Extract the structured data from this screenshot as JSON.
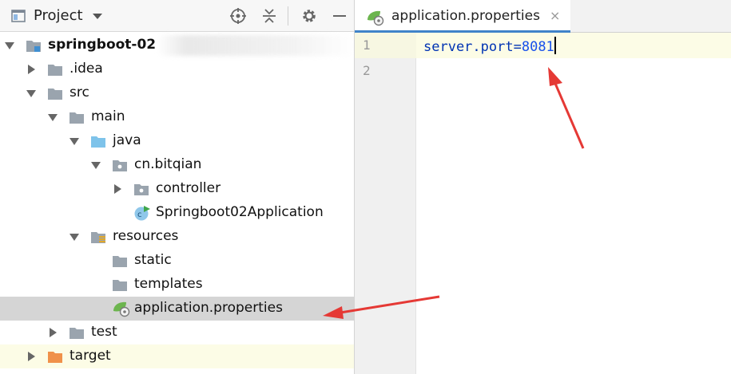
{
  "project_panel": {
    "title": "Project",
    "tree": [
      {
        "label": "springboot-02",
        "bold": true
      },
      {
        "label": ".idea"
      },
      {
        "label": "src"
      },
      {
        "label": "main"
      },
      {
        "label": "java"
      },
      {
        "label": "cn.bitqian"
      },
      {
        "label": "controller"
      },
      {
        "label": "Springboot02Application"
      },
      {
        "label": "resources"
      },
      {
        "label": "static"
      },
      {
        "label": "templates"
      },
      {
        "label": "application.properties"
      },
      {
        "label": "test"
      },
      {
        "label": "target"
      }
    ]
  },
  "editor": {
    "tab_label": "application.properties",
    "tab_close": "×",
    "line_numbers": [
      "1",
      "2"
    ],
    "code": {
      "key": "server.port",
      "eq": "=",
      "value": "8081"
    }
  },
  "colors": {
    "selected_row": "#d5d5d5",
    "highlight_row": "#fcfce6",
    "annotation_arrow": "#e53935",
    "tab_underline": "#4083c9"
  }
}
